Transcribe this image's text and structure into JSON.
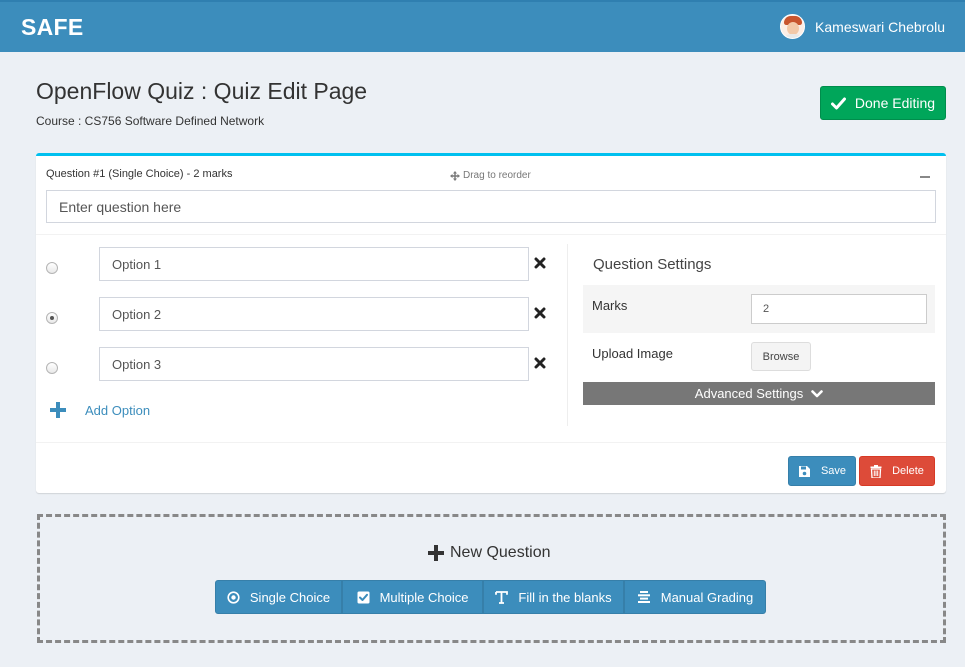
{
  "navbar": {
    "brand": "SAFE",
    "user_name": "Kameswari Chebrolu"
  },
  "header": {
    "title": "OpenFlow Quiz : Quiz Edit Page",
    "course": "Course : CS756 Software Defined Network",
    "done_label": "Done Editing"
  },
  "question": {
    "header": "Question #1 (Single Choice) - 2 marks",
    "drag_label": "Drag to reorder",
    "placeholder": "Enter question here",
    "options": [
      {
        "label": "Option 1",
        "selected": false
      },
      {
        "label": "Option 2",
        "selected": true
      },
      {
        "label": "Option 3",
        "selected": false
      }
    ],
    "add_option_label": "Add Option",
    "settings": {
      "title": "Question Settings",
      "marks_label": "Marks",
      "marks_value": "2",
      "upload_label": "Upload Image",
      "browse_label": "Browse",
      "advanced_label": "Advanced Settings"
    },
    "save_label": "Save",
    "delete_label": "Delete"
  },
  "new_question": {
    "title": "New Question",
    "types": [
      "Single Choice",
      "Multiple Choice",
      "Fill in the blanks",
      "Manual Grading"
    ]
  },
  "colors": {
    "primary": "#3c8dbc",
    "success": "#00a65a",
    "danger": "#dd4b39",
    "accent": "#00c0ef",
    "gray": "#777777"
  },
  "icons": {
    "done": "check-icon",
    "drag": "move-icon",
    "collapse": "minus-icon",
    "remove": "times-icon",
    "add": "plus-icon",
    "advanced": "chevron-down-icon",
    "save": "save-icon",
    "delete": "trash-icon",
    "single_choice": "radio-circle-icon",
    "multiple_choice": "checkbox-icon",
    "fill_blanks": "text-icon",
    "manual_grading": "align-center-icon"
  }
}
